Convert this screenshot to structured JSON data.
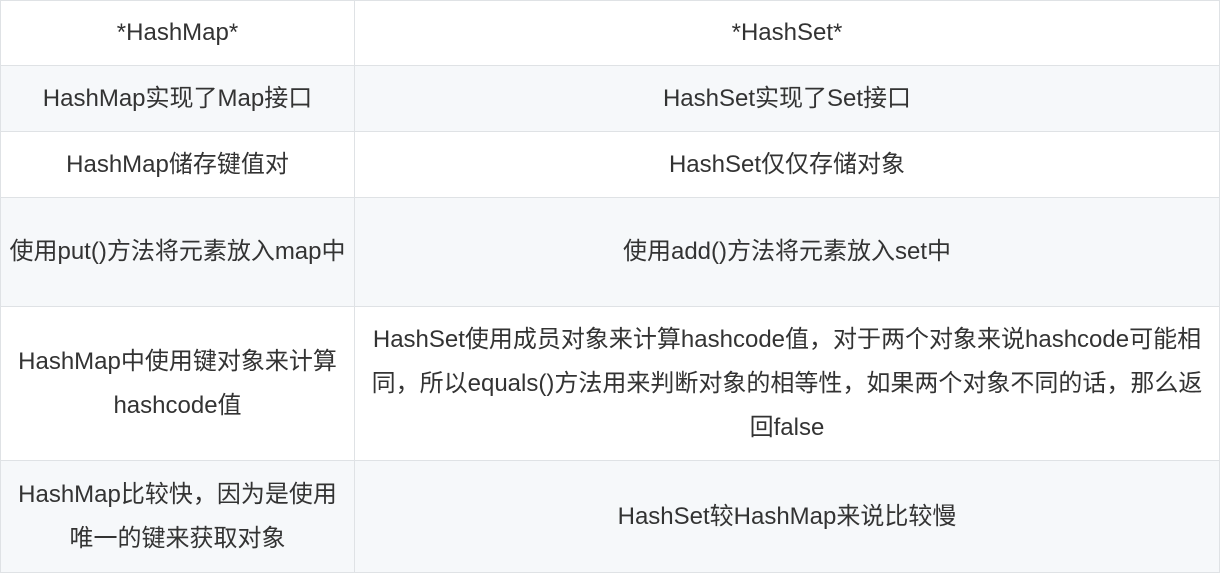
{
  "table": {
    "headers": [
      "*HashMap*",
      "*HashSet*"
    ],
    "rows": [
      [
        "HashMap实现了Map接口",
        "HashSet实现了Set接口"
      ],
      [
        "HashMap储存键值对",
        "HashSet仅仅存储对象"
      ],
      [
        "使用put()方法将元素放入map中",
        "使用add()方法将元素放入set中"
      ],
      [
        "HashMap中使用键对象来计算hashcode值",
        "HashSet使用成员对象来计算hashcode值，对于两个对象来说hashcode可能相同，所以equals()方法用来判断对象的相等性，如果两个对象不同的话，那么返回false"
      ],
      [
        "HashMap比较快，因为是使用唯一的键来获取对象",
        "HashSet较HashMap来说比较慢"
      ]
    ]
  },
  "colors": {
    "border": "#dfe2e5",
    "row_shade": "#f6f8fa",
    "text": "#333333"
  }
}
